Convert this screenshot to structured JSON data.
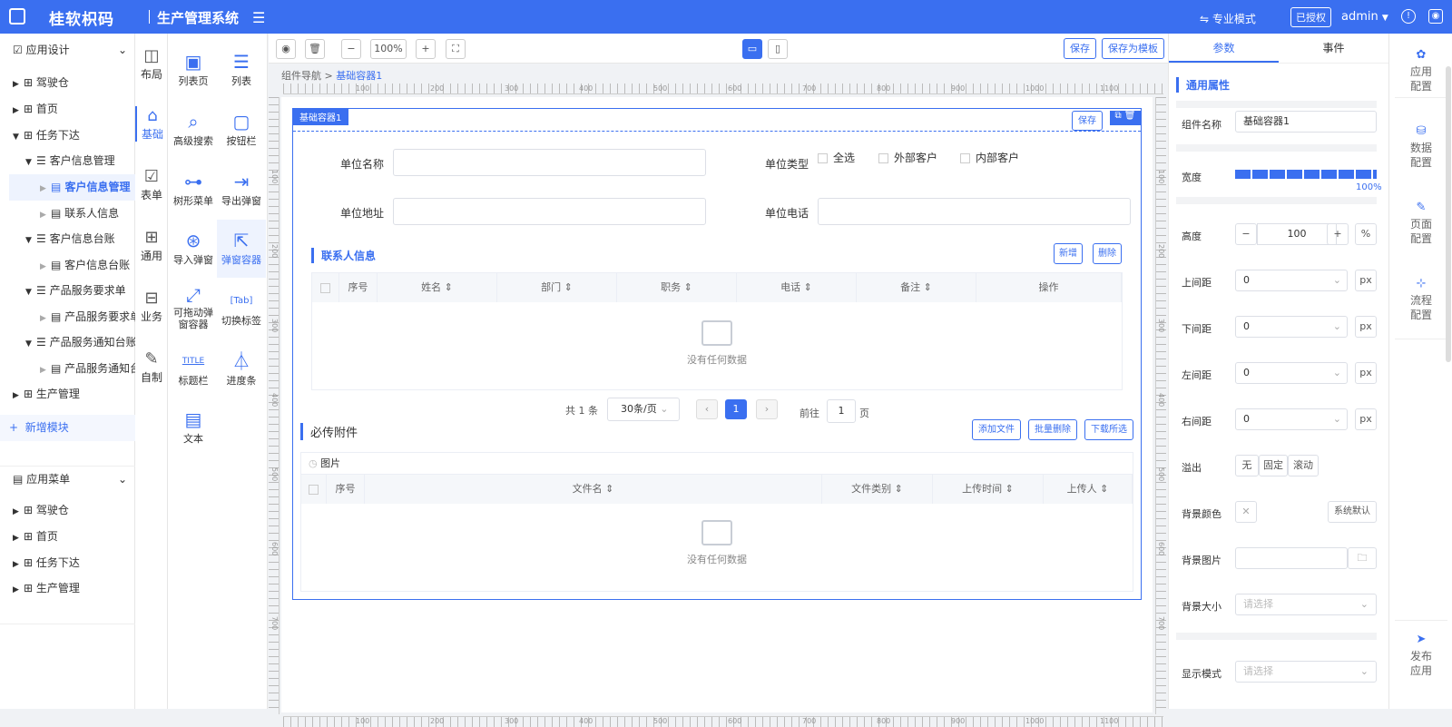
{
  "top": {
    "brand": "桂软枳码",
    "system": "生产管理系统",
    "mode": "专业模式",
    "license": "已授权",
    "user": "admin"
  },
  "tree": {
    "app_design": "应用设计",
    "items": [
      "驾驶仓",
      "首页",
      "任务下达",
      "客户信息管理",
      "客户信息管理",
      "联系人信息",
      "客户信息台账",
      "客户信息台账",
      "产品服务要求单",
      "产品服务要求单",
      "产品服务通知台账",
      "产品服务通知台",
      "生产管理"
    ],
    "add_module": "新增模块",
    "app_menu": "应用菜单",
    "menu_items": [
      "驾驶仓",
      "首页",
      "任务下达",
      "生产管理"
    ]
  },
  "categories": [
    "布局",
    "基础",
    "表单",
    "通用",
    "业务",
    "自制"
  ],
  "components": [
    "列表页",
    "列表",
    "高级搜索",
    "按钮栏",
    "树形菜单",
    "导出弹窗",
    "导入弹窗",
    "弹窗容器",
    "可拖动弹窗容器",
    "切换标签",
    "标题栏",
    "进度条",
    "文本"
  ],
  "toolbar": {
    "zoom": "100%",
    "save": "保存",
    "save_tpl": "保存为模板"
  },
  "breadcrumb": {
    "root": "组件导航",
    "current": "基础容器1"
  },
  "ruler_h": [
    "100",
    "200",
    "300",
    "400",
    "500",
    "600",
    "700",
    "800",
    "900",
    "1000",
    "1100"
  ],
  "ruler_v": [
    "100",
    "200",
    "300",
    "400",
    "500",
    "600",
    "700"
  ],
  "container": {
    "tag": "基础容器1",
    "save": "保存"
  },
  "form": {
    "unit_name": "单位名称",
    "unit_type": "单位类型",
    "select_all": "全选",
    "external": "外部客户",
    "internal": "内部客户",
    "unit_addr": "单位地址",
    "unit_phone": "单位电话"
  },
  "contacts": {
    "title": "联系人信息",
    "add": "新增",
    "delete": "删除",
    "cols": [
      "序号",
      "姓名",
      "部门",
      "职务",
      "电话",
      "备注",
      "操作"
    ],
    "empty": "没有任何数据"
  },
  "pager": {
    "total": "共 1 条",
    "size": "30条/页",
    "page": "1",
    "goto": "前往",
    "goto_val": "1",
    "unit": "页"
  },
  "attach": {
    "title": "必传附件",
    "add": "添加文件",
    "batch_del": "批量删除",
    "download": "下载所选",
    "group": "图片",
    "cols": [
      "序号",
      "文件名",
      "文件类别",
      "上传时间",
      "上传人"
    ],
    "empty": "没有任何数据"
  },
  "props": {
    "tab_params": "参数",
    "tab_events": "事件",
    "section": "通用属性",
    "name_label": "组件名称",
    "name_value": "基础容器1",
    "width_label": "宽度",
    "width_value": "100%",
    "height_label": "高度",
    "height_value": "100",
    "pct": "%",
    "mt": "上间距",
    "mb": "下间距",
    "ml": "左间距",
    "mr": "右间距",
    "zero": "0",
    "px": "px",
    "overflow_label": "溢出",
    "ov": [
      "无",
      "固定",
      "滚动"
    ],
    "bg_color": "背景颜色",
    "sys_default": "系统默认",
    "bg_img": "背景图片",
    "bg_size": "背景大小",
    "select_ph": "请选择",
    "display_mode": "显示模式"
  },
  "rightside": {
    "items": [
      "应用\n配置",
      "数据\n配置",
      "页面\n配置",
      "流程\n配置"
    ],
    "publish": "发布\n应用"
  },
  "colors": {
    "primary": "#3a6ff0"
  }
}
